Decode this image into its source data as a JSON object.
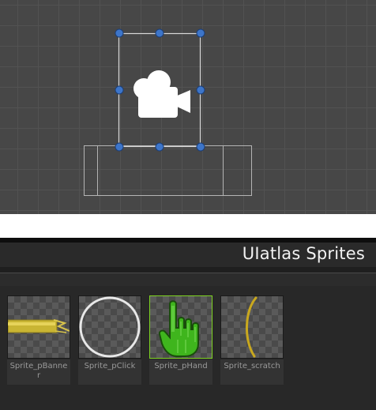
{
  "scene_view": {
    "camera_icon": "video-camera-icon",
    "handle_color": "#3d75c9"
  },
  "atlas_panel": {
    "title": "UIatlas Sprites",
    "sprites": [
      {
        "name": "Sprite_pBanner",
        "icon": "yellow-banner",
        "selected": false
      },
      {
        "name": "Sprite_pClick",
        "icon": "white-ring",
        "selected": false
      },
      {
        "name": "Sprite_pHand",
        "icon": "green-hand-pointer",
        "selected": true
      },
      {
        "name": "Sprite_scratch",
        "icon": "yellow-arc-scratch",
        "selected": false
      }
    ],
    "selected_color": "#7ed321"
  }
}
